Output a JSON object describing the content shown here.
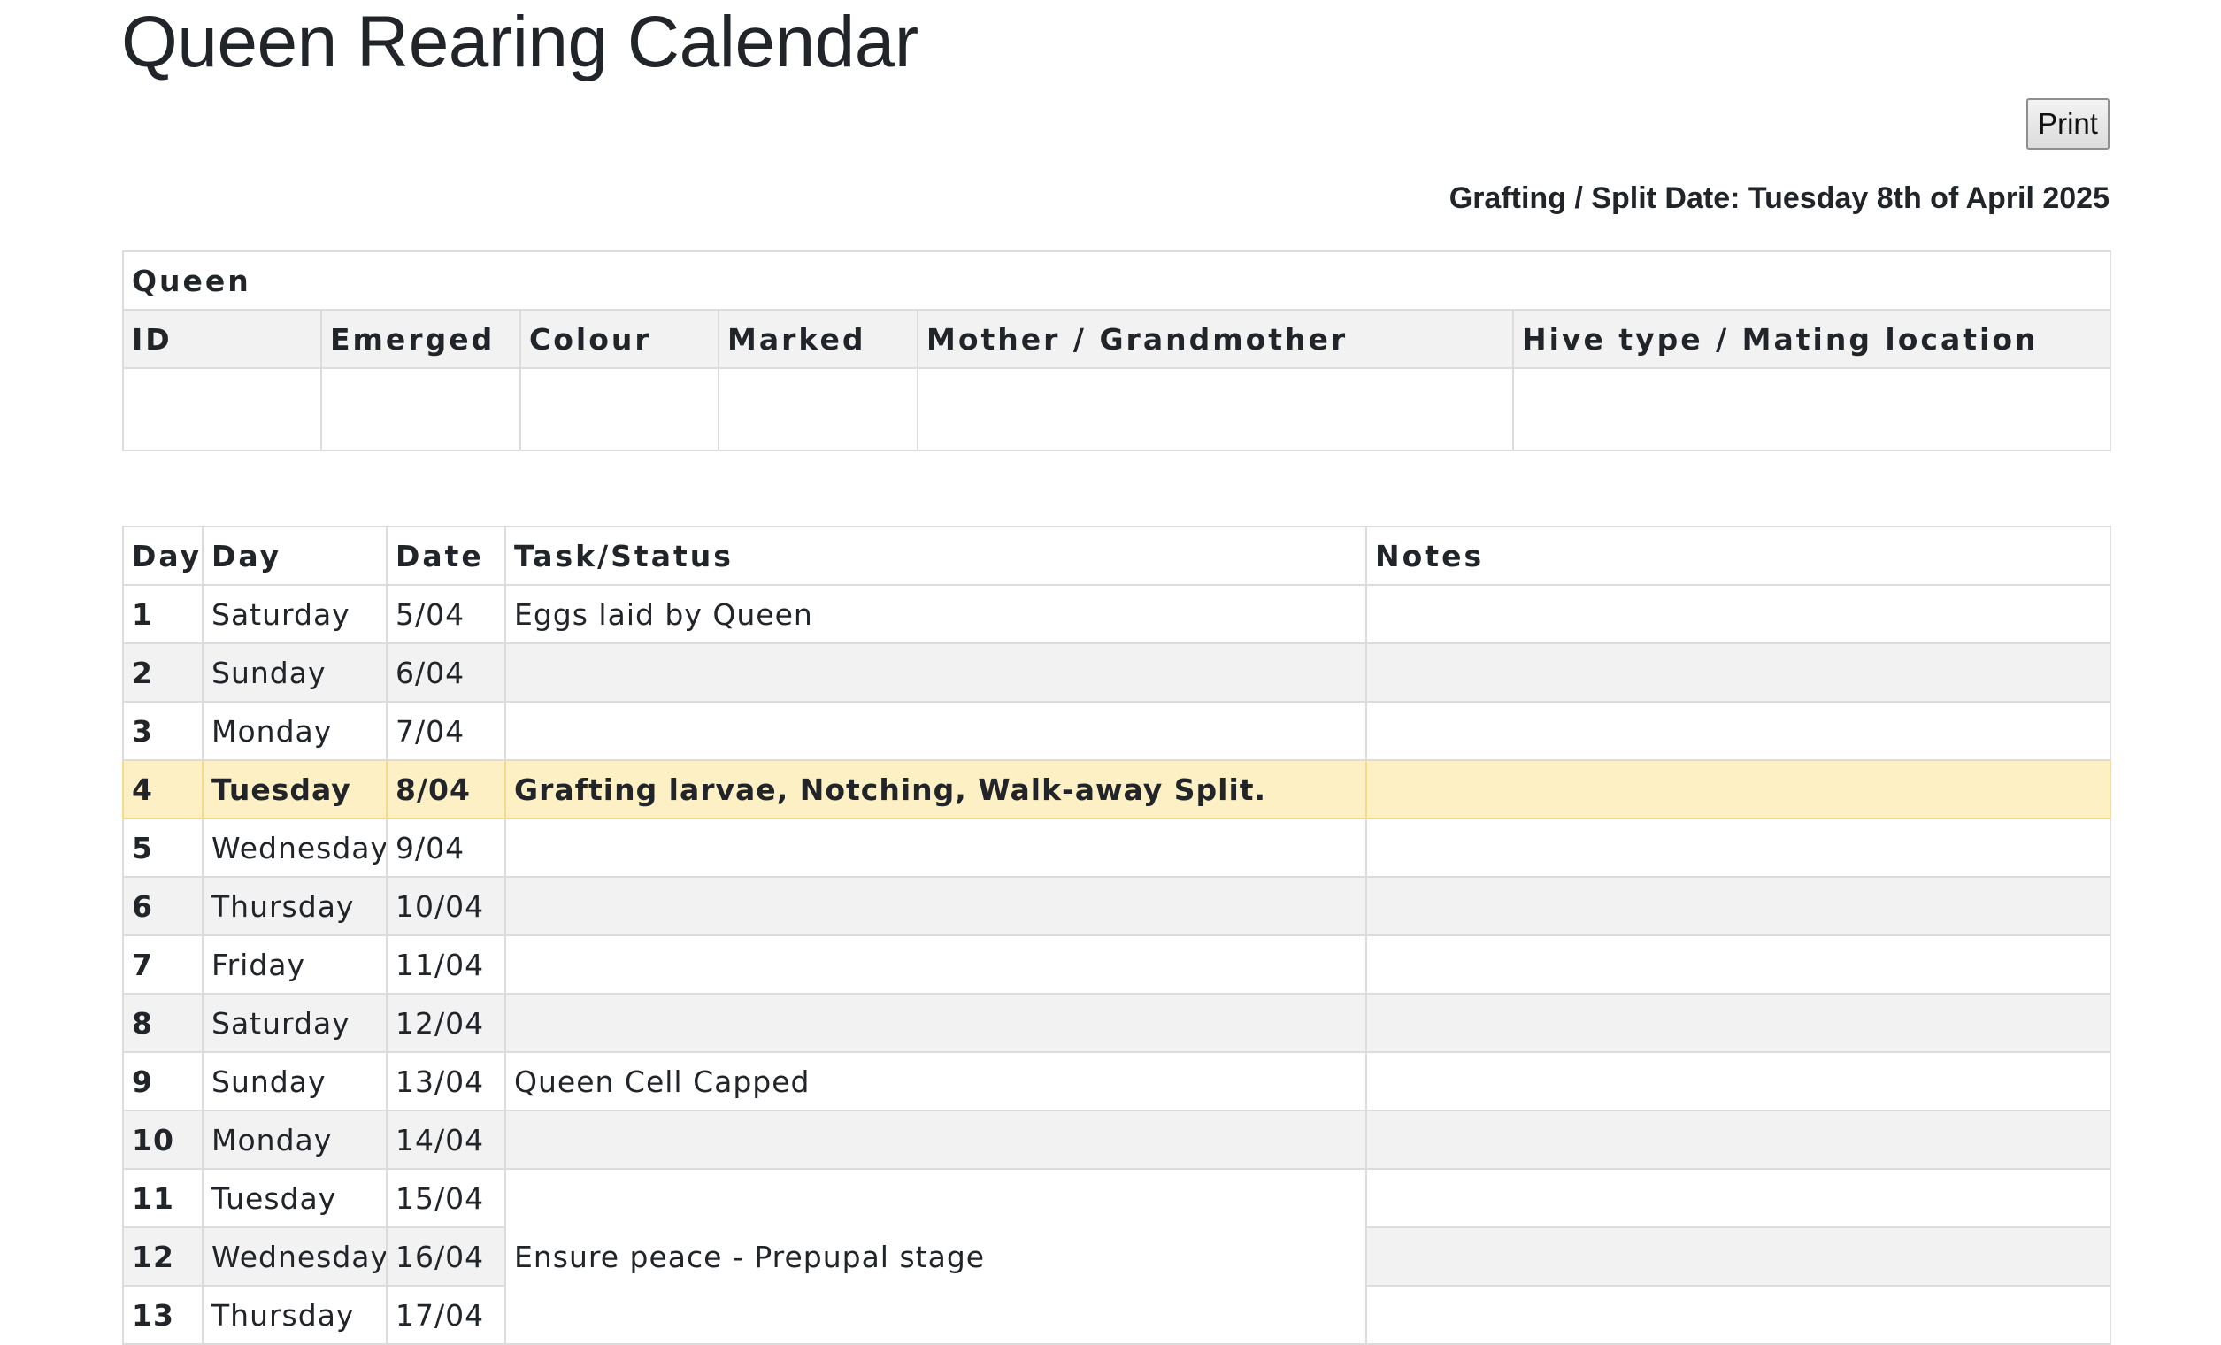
{
  "page": {
    "title": "Queen Rearing Calendar",
    "print_label": "Print",
    "grafting_date": "Grafting / Split Date: Tuesday 8th of April 2025"
  },
  "queen_table": {
    "caption": "Queen",
    "headers": [
      "ID",
      "Emerged",
      "Colour",
      "Marked",
      "Mother / Grandmother",
      "Hive type / Mating location"
    ]
  },
  "calendar": {
    "headers": [
      "Day",
      "Day",
      "Date",
      "Task/Status",
      "Notes"
    ],
    "rows": [
      {
        "num": "1",
        "weekday": "Saturday",
        "date": "5/04",
        "task": "Eggs laid by Queen",
        "notes": ""
      },
      {
        "num": "2",
        "weekday": "Sunday",
        "date": "6/04",
        "task": "",
        "notes": ""
      },
      {
        "num": "3",
        "weekday": "Monday",
        "date": "7/04",
        "task": "",
        "notes": ""
      },
      {
        "num": "4",
        "weekday": "Tuesday",
        "date": "8/04",
        "task": "Grafting larvae, Notching, Walk-away Split.",
        "notes": "",
        "highlight": true
      },
      {
        "num": "5",
        "weekday": "Wednesday",
        "date": "9/04",
        "task": "",
        "notes": ""
      },
      {
        "num": "6",
        "weekday": "Thursday",
        "date": "10/04",
        "task": "",
        "notes": ""
      },
      {
        "num": "7",
        "weekday": "Friday",
        "date": "11/04",
        "task": "",
        "notes": ""
      },
      {
        "num": "8",
        "weekday": "Saturday",
        "date": "12/04",
        "task": "",
        "notes": ""
      },
      {
        "num": "9",
        "weekday": "Sunday",
        "date": "13/04",
        "task": "Queen Cell Capped",
        "notes": ""
      },
      {
        "num": "10",
        "weekday": "Monday",
        "date": "14/04",
        "task": "",
        "notes": ""
      },
      {
        "num": "11",
        "weekday": "Tuesday",
        "date": "15/04",
        "notes": ""
      },
      {
        "num": "12",
        "weekday": "Wednesday",
        "date": "16/04",
        "notes": ""
      },
      {
        "num": "13",
        "weekday": "Thursday",
        "date": "17/04",
        "notes": ""
      }
    ],
    "merged_task": "Ensure peace - Prepupal stage"
  },
  "colors": {
    "highlight_row": "#fdf0c4",
    "stripe_row": "#f2f2f2",
    "border": "#dcdcdc",
    "text": "#212529"
  }
}
